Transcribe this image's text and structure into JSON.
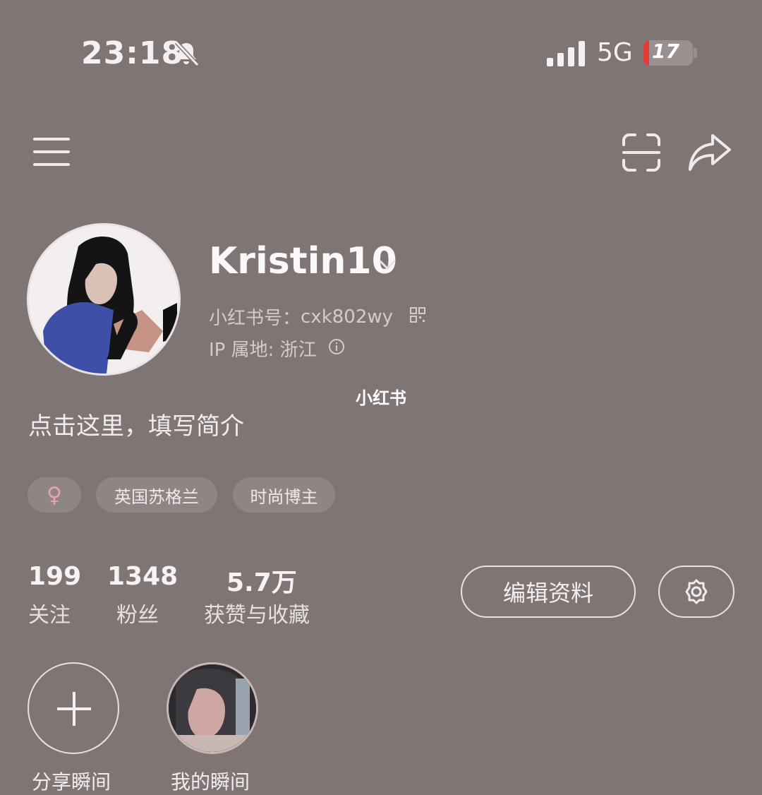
{
  "status_bar": {
    "time": "23:18",
    "network": "5G",
    "battery": "17"
  },
  "profile": {
    "username": "Kristin10",
    "red_id_label": "小红书号：",
    "red_id": "cxk802wy",
    "ip_label": "IP 属地: ",
    "ip_location": "浙江",
    "bio": "点击这里，填写简介",
    "gender_symbol": "♀",
    "tags": [
      "英国苏格兰",
      "时尚博主"
    ]
  },
  "watermark": "小红书",
  "stats": [
    {
      "value": "199",
      "label": "关注"
    },
    {
      "value": "1348",
      "label": "粉丝"
    },
    {
      "value": "5.7万",
      "label": "获赞与收藏"
    }
  ],
  "actions": {
    "edit_profile": "编辑资料"
  },
  "moments": {
    "add_label": "分享瞬间",
    "mine_label": "我的瞬间"
  },
  "icons": [
    "bell-off-icon",
    "signal-icon",
    "battery-icon",
    "menu-icon",
    "scan-icon",
    "share-icon",
    "chevron-down-icon",
    "qr-code-icon",
    "info-icon",
    "female-icon",
    "settings-icon",
    "plus-icon"
  ],
  "colors": {
    "background": "#7f7574",
    "gender_accent": "#e6a3b5",
    "battery_low": "#e53935"
  }
}
